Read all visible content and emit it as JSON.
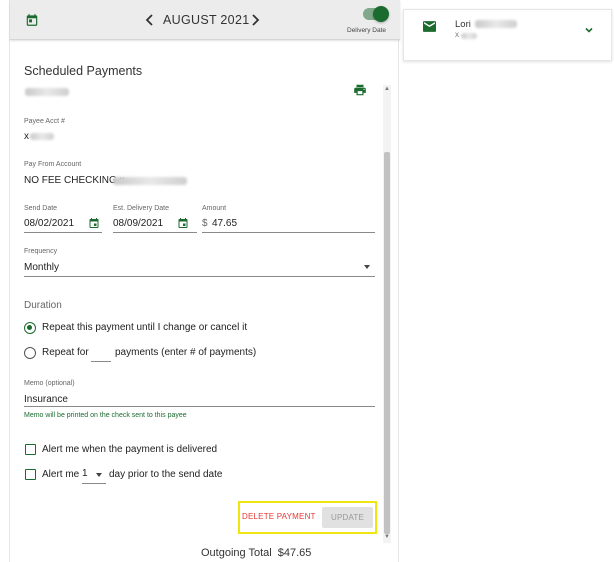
{
  "header": {
    "month": "AUGUST 2021",
    "toggle_label": "Delivery Date",
    "icons": {
      "calendar": "calendar-icon",
      "prev": "chevron-left-icon",
      "next": "chevron-right-icon"
    }
  },
  "form": {
    "title": "Scheduled Payments",
    "payee_acct_label": "Payee Acct #",
    "payee_acct_value": "x",
    "pay_from_label": "Pay From Account",
    "pay_from_value": "NO FEE CHECKING x",
    "send_date_label": "Send Date",
    "send_date_value": "08/02/2021",
    "delivery_date_label": "Est. Delivery Date",
    "delivery_date_value": "08/09/2021",
    "amount_label": "Amount",
    "currency_symbol": "$",
    "amount_value": "47.65",
    "frequency_label": "Frequency",
    "frequency_value": "Monthly",
    "duration_label": "Duration",
    "repeat_until_label": "Repeat this payment until I change or cancel it",
    "repeat_for_label": "Repeat for",
    "repeat_for_suffix": "payments (enter # of payments)",
    "memo_label": "Memo (optional)",
    "memo_value": "Insurance",
    "memo_hint": "Memo will be printed on the check sent to this payee",
    "alert_delivered_label": "Alert me when the payment is delivered",
    "alert_prior_prefix": "Alert me",
    "alert_prior_days": "1",
    "alert_prior_suffix": "day prior to the send date"
  },
  "actions": {
    "delete_label": "DELETE PAYMENT",
    "update_label": "UPDATE"
  },
  "footer": {
    "outgoing_label": "Outgoing Total",
    "outgoing_value": "$47.65"
  },
  "contact": {
    "name": "Lori",
    "sub": "x"
  },
  "colors": {
    "accent": "#1b6b2f",
    "danger": "#e53935",
    "highlight": "#f0e60f"
  }
}
